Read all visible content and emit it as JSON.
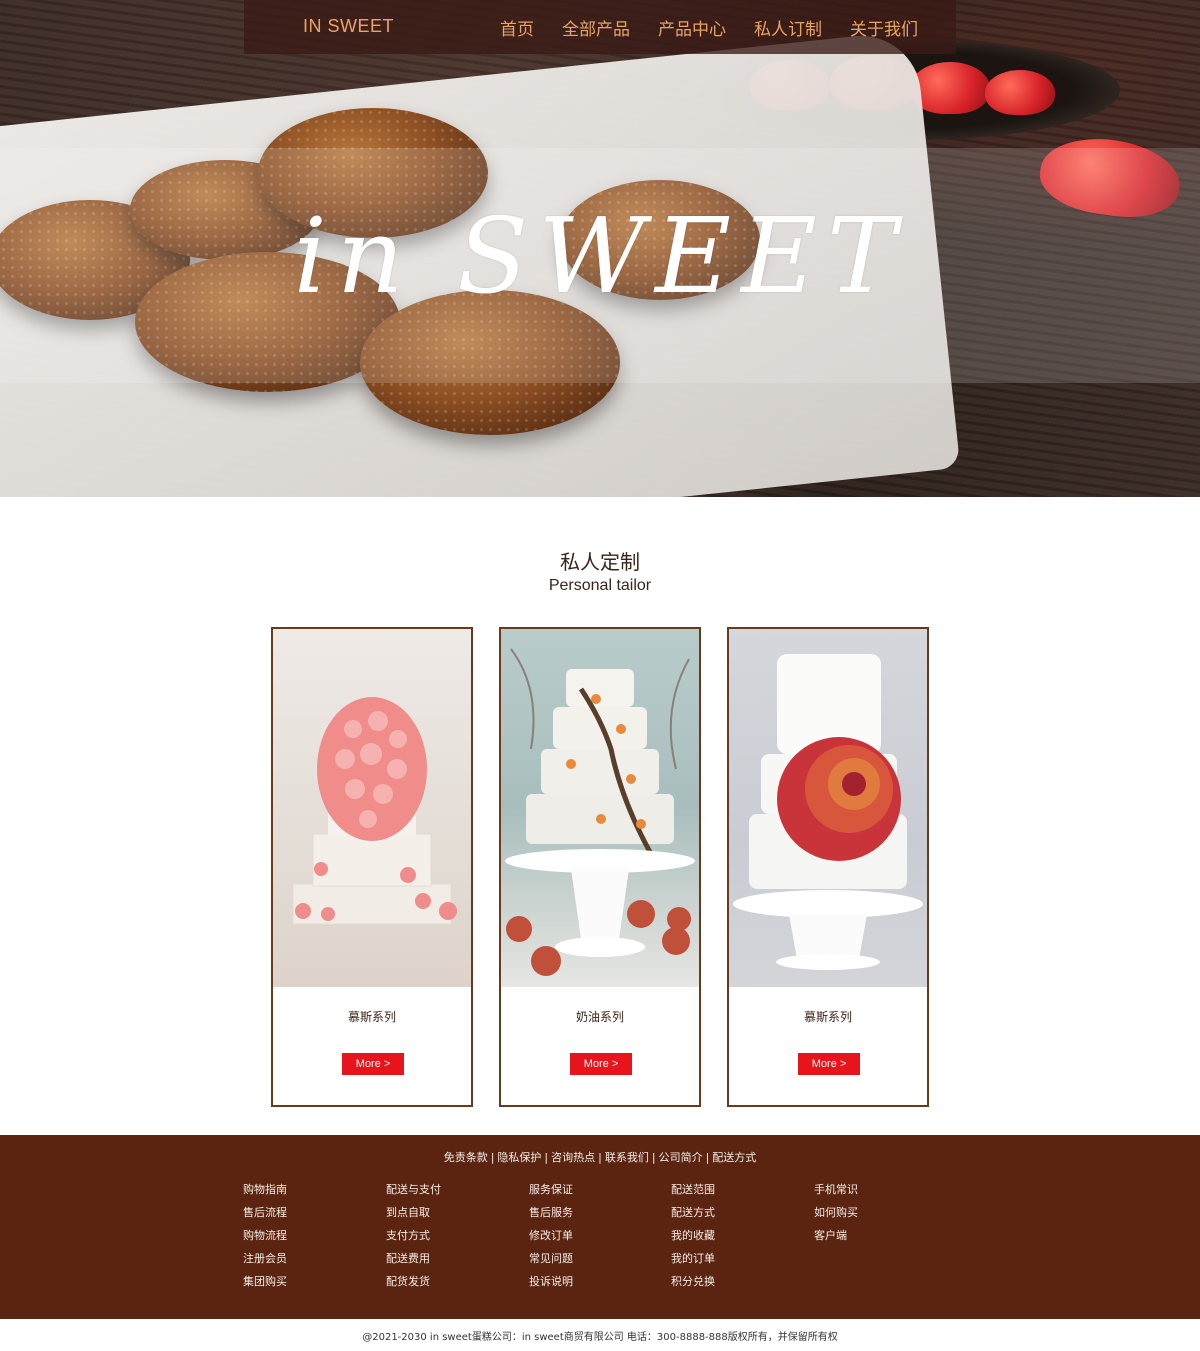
{
  "nav": {
    "brand": "IN SWEET",
    "items": [
      "首页",
      "全部产品",
      "产品中心",
      "私人订制",
      "关于我们"
    ]
  },
  "hero": {
    "title": "in SWEET"
  },
  "section": {
    "title": "私人定制",
    "subtitle": "Personal tailor"
  },
  "cards": [
    {
      "name": "慕斯系列",
      "button": "More >"
    },
    {
      "name": "奶油系列",
      "button": "More >"
    },
    {
      "name": "慕斯系列",
      "button": "More >"
    }
  ],
  "footer": {
    "links": [
      "免责条款",
      "隐私保护",
      "咨询热点",
      "联系我们",
      "公司简介",
      "配送方式"
    ],
    "columns": [
      [
        "购物指南",
        "售后流程",
        "购物流程",
        "注册会员",
        "集团购买"
      ],
      [
        "配送与支付",
        "到点自取",
        "支付方式",
        "配送费用",
        "配货发货"
      ],
      [
        "服务保证",
        "售后服务",
        "修改订单",
        "常见问题",
        "投诉说明"
      ],
      [
        "配送范围",
        "配送方式",
        "我的收藏",
        "我的订单",
        "积分兑换"
      ],
      [
        "手机常识",
        "如何购买",
        "客户端"
      ]
    ],
    "copyright": "@2021-2030 in sweet蛋糕公司：in sweet商贸有限公司 电话：300-8888-888版权所有，并保留所有权"
  },
  "colors": {
    "brand_brown": "#5a2411",
    "nav_text": "#e9a466",
    "button_red": "#e8141c",
    "card_border": "#6b3a1c"
  }
}
